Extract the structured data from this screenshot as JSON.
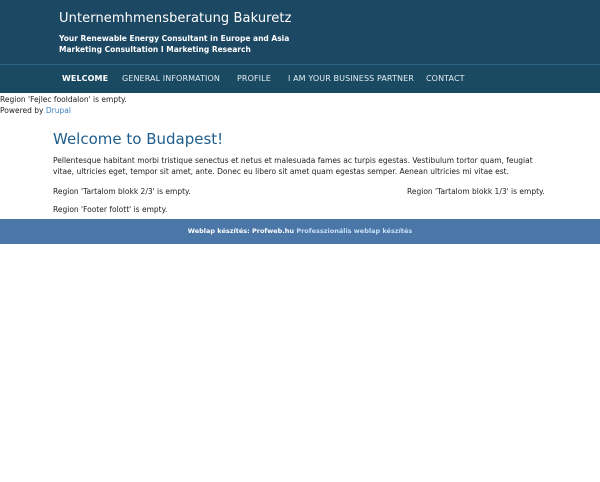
{
  "header": {
    "site_name": "Unternemhmensberatung Bakuretz",
    "slogan_line1": "Your Renewable Energy Consultant in Europe and Asia",
    "slogan_line2": "Marketing Consultation I Marketing Research"
  },
  "nav": {
    "items": [
      {
        "label": "WELCOME",
        "active": true
      },
      {
        "label": "GENERAL INFORMATION",
        "active": false
      },
      {
        "label": "PROFILE",
        "active": false
      },
      {
        "label": "I AM YOUR BUSINESS PARTNER",
        "active": false
      },
      {
        "label": "CONTACT",
        "active": false
      }
    ]
  },
  "messages": {
    "region_header": "Region 'Fejlec fooldalon' is empty.",
    "powered_by": "Powered by ",
    "drupal_link": "Drupal"
  },
  "main": {
    "title": "Welcome to Budapest!",
    "body": "Pellentesque habitant morbi tristique senectus et netus et malesuada fames ac turpis egestas. Vestibulum tortor quam, feugiat vitae, ultricies eget, tempor sit amet, ante. Donec eu libero sit amet quam egestas semper. Aenean ultricies mi vitae est.",
    "region_left": "Region 'Tartalom blokk 2/3' is empty.",
    "region_right": "Region 'Tartalom blokk 1/3' is empty.",
    "region_footer": "Region 'Footer folott' is empty."
  },
  "footer": {
    "prefix": "Weblap készítés: Profweb.hu ",
    "link": "Professzionális weblap készítés"
  }
}
